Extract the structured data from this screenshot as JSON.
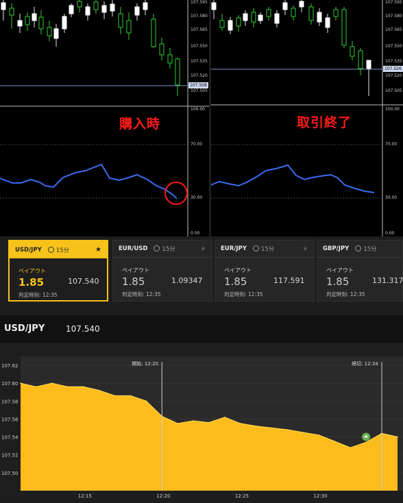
{
  "top_left_chart": {
    "price_ticks": [
      "107.595",
      "107.580",
      "107.565",
      "107.550",
      "107.535",
      "107.520",
      "107.505"
    ],
    "price_marker": "107.508",
    "osc_ticks": [
      "100.00",
      "70.00",
      "30.00",
      "0.00"
    ],
    "callout": "購入時"
  },
  "top_right_chart": {
    "price_ticks": [
      "107.595",
      "107.580",
      "107.565",
      "107.550",
      "107.535",
      "107.520",
      "107.505"
    ],
    "price_marker": "107.526",
    "osc_ticks": [
      "100.00",
      "70.00",
      "30.00",
      "0.00"
    ],
    "callout": "取引終了"
  },
  "cards": [
    {
      "symbol": "USD/JPY",
      "duration": "15分",
      "payout_label": "ペイアウト",
      "payout": "1.85",
      "price": "107.540",
      "judge": "判定時刻: 12:35",
      "active": true
    },
    {
      "symbol": "EUR/USD",
      "duration": "15分",
      "payout_label": "ペイアウト",
      "payout": "1.85",
      "price": "1.09347",
      "judge": "判定時刻: 12:35",
      "active": false
    },
    {
      "symbol": "EUR/JPY",
      "duration": "15分",
      "payout_label": "ペイアウト",
      "payout": "1.85",
      "price": "117.591",
      "judge": "判定時刻: 12:35",
      "active": false
    },
    {
      "symbol": "GBP/JPY",
      "duration": "15分",
      "payout_label": "ペイアウト",
      "payout": "1.85",
      "price": "131.317",
      "judge": "判定時刻: 12:35",
      "active": false
    }
  ],
  "header": {
    "symbol": "USD/JPY",
    "price": "107.540"
  },
  "chart_data": {
    "type": "area",
    "x_ticks": [
      "12:15",
      "12:20",
      "12:25",
      "12:30"
    ],
    "y_ticks": [
      "107.62",
      "107.60",
      "107.58",
      "107.56",
      "107.54",
      "107.52",
      "107.50"
    ],
    "ylim": [
      107.48,
      107.63
    ],
    "start_label": "開始: 12:20",
    "end_label": "締切: 12:34",
    "x": [
      "12:11",
      "12:12",
      "12:13",
      "12:14",
      "12:15",
      "12:16",
      "12:17",
      "12:18",
      "12:19",
      "12:20",
      "12:21",
      "12:22",
      "12:23",
      "12:24",
      "12:25",
      "12:26",
      "12:27",
      "12:28",
      "12:29",
      "12:30",
      "12:31",
      "12:32",
      "12:33",
      "12:34",
      "12:35"
    ],
    "values": [
      107.6,
      107.596,
      107.6,
      107.596,
      107.596,
      107.592,
      107.586,
      107.586,
      107.58,
      107.563,
      107.555,
      107.558,
      107.556,
      107.562,
      107.555,
      107.552,
      107.55,
      107.548,
      107.545,
      107.542,
      107.535,
      107.528,
      107.534,
      107.544,
      107.54
    ],
    "colors": {
      "fill": "#fbbc1c",
      "line": "#ffd54a",
      "marker": "#6ab04c"
    }
  }
}
